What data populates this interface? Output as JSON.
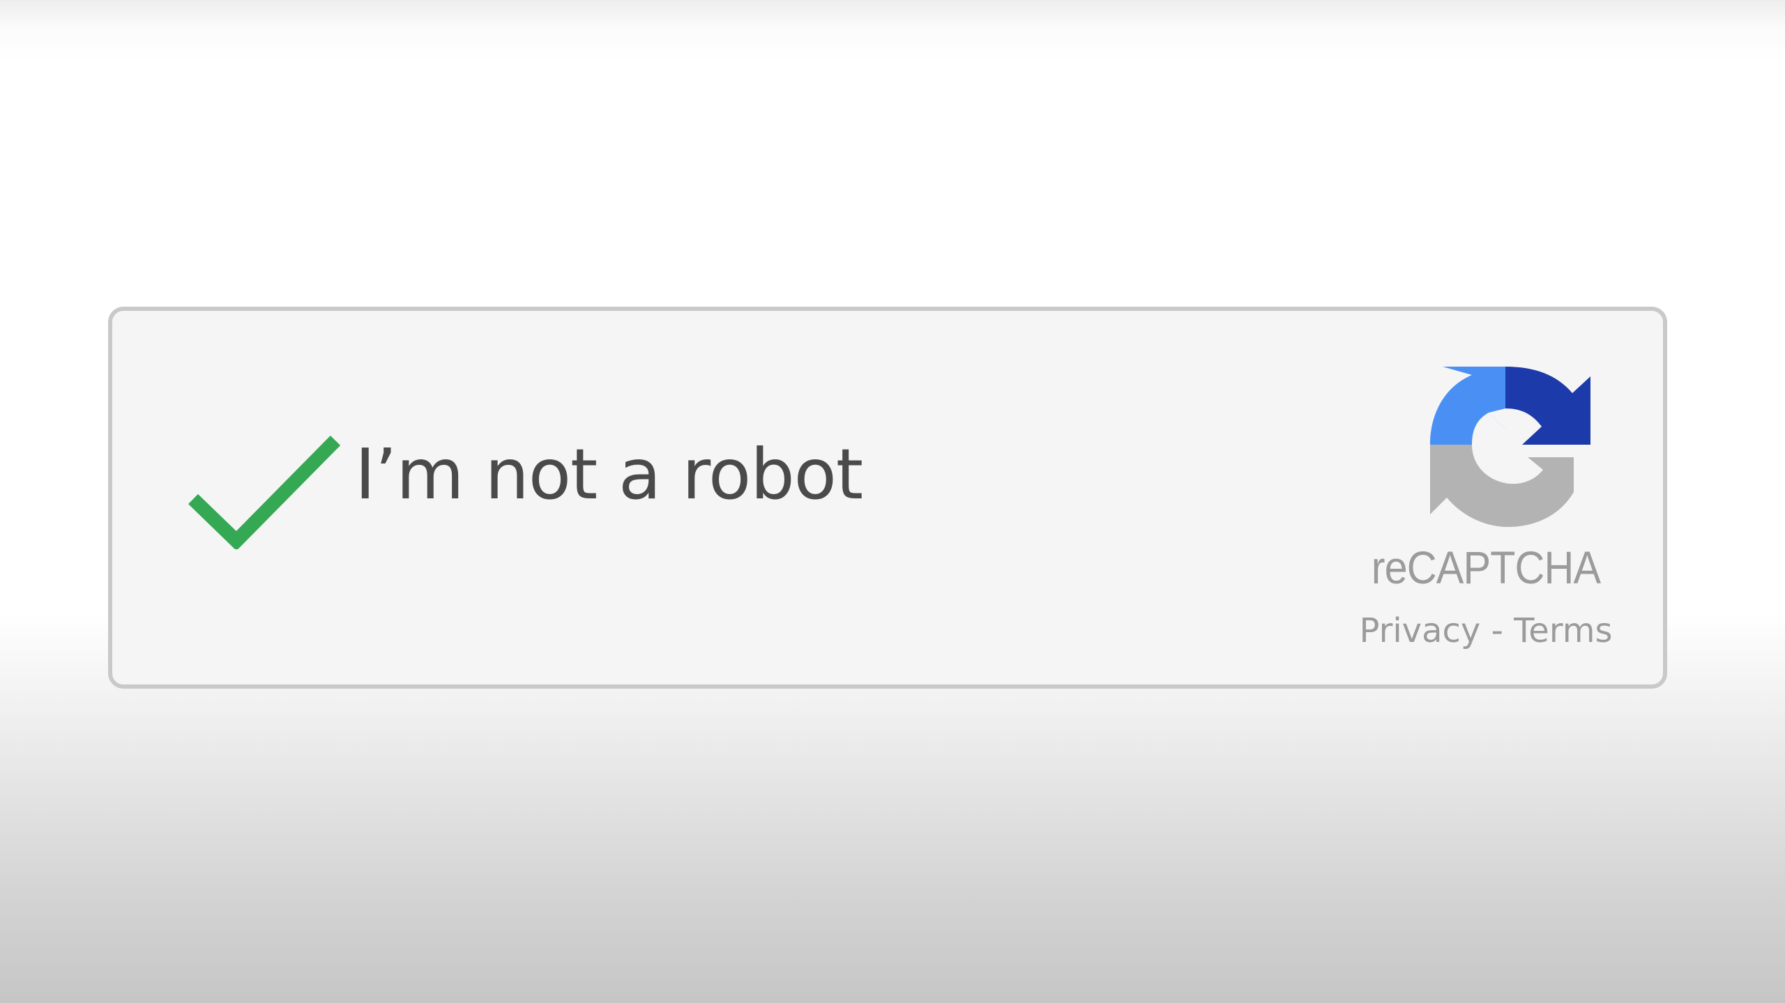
{
  "captcha": {
    "label": "I’m not a robot",
    "checked": true,
    "brand": "reCAPTCHA",
    "privacy_link": "Privacy",
    "separator": "-",
    "terms_link": "Terms"
  },
  "icons": {
    "checkmark": "checkmark-icon",
    "logo": "recaptcha-logo-icon"
  },
  "colors": {
    "checkmark": "#34a853",
    "logo_light_blue": "#4a90f4",
    "logo_dark_blue": "#1c3aa9",
    "logo_gray": "#b3b3b3",
    "text": "#4a4a4a",
    "muted_text": "#9b9b9b",
    "box_background": "#f5f5f5",
    "box_border": "#c9c9c9"
  }
}
